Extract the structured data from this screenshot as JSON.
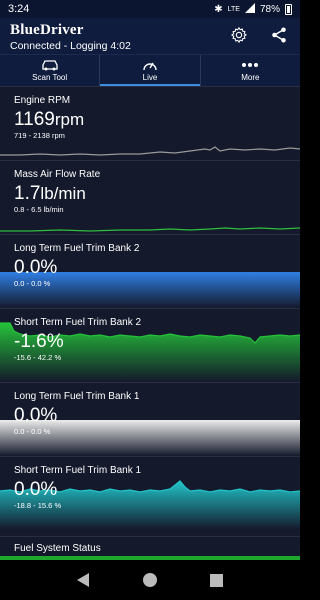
{
  "status_bar": {
    "time": "3:24",
    "network": "LTE",
    "battery": "78%"
  },
  "app_bar": {
    "brand": "BlueDriver",
    "connection": "Connected - Logging 4:02",
    "icons": [
      "gear-icon",
      "share-icon"
    ]
  },
  "tabs": [
    {
      "label": "Scan Tool",
      "icon": "car-icon"
    },
    {
      "label": "Live",
      "icon": "gauge-icon",
      "active": true
    },
    {
      "label": "More",
      "icon": "more-icon"
    }
  ],
  "cards": [
    {
      "name": "Engine RPM",
      "value": "1169",
      "unit": "rpm",
      "range": "719 - 2138 rpm",
      "fill_color": "#8a8a8a",
      "stroke_color": "#9a9a9a"
    },
    {
      "name": "Mass Air Flow Rate",
      "value": "1.7",
      "unit": "lb/min",
      "range": "0.8 - 6.5 lb/min",
      "fill_color": "#1e7d2a",
      "stroke_color": "#2fbf3b"
    },
    {
      "name": "Long Term Fuel Trim Bank 2",
      "value": "0.0%",
      "unit": "",
      "range": "0.0 - 0.0 %",
      "fill_color": "#1e5fb8",
      "stroke_color": "#2f7ce0"
    },
    {
      "name": "Short Term Fuel Trim Bank 2",
      "value": "-1.6%",
      "unit": "",
      "range": "-15.6 - 42.2 %",
      "fill_color": "#168a28",
      "stroke_color": "#25c23a"
    },
    {
      "name": "Long Term Fuel Trim Bank 1",
      "value": "0.0%",
      "unit": "",
      "range": "0.0 - 0.0 %",
      "fill_color": "#c9c9c9",
      "stroke_color": "#e6e6e6"
    },
    {
      "name": "Short Term Fuel Trim Bank 1",
      "value": "0.0%",
      "unit": "",
      "range": "-18.8 - 15.6 %",
      "fill_color": "#128a8e",
      "stroke_color": "#22c4c8"
    }
  ],
  "last_card": {
    "name": "Fuel System Status",
    "color": "#1fa82e"
  },
  "nav_bar": [
    "back-icon",
    "home-icon",
    "recents-icon"
  ]
}
